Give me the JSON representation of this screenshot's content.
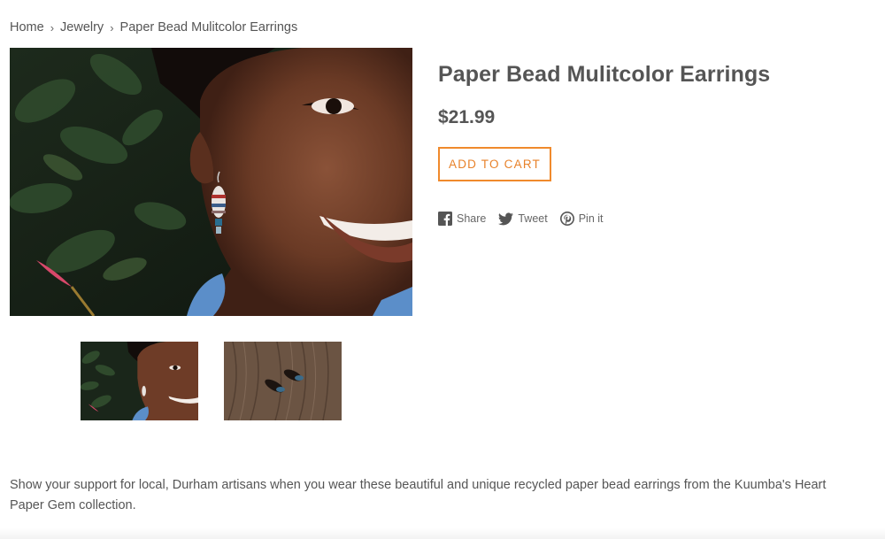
{
  "breadcrumb": {
    "home": "Home",
    "separator": "›",
    "category": "Jewelry",
    "current": "Paper Bead Mulitcolor Earrings"
  },
  "product": {
    "title": "Paper Bead Mulitcolor Earrings",
    "price": "$21.99",
    "add_to_cart_label": "ADD TO CART",
    "description": "Show your support for local, Durham artisans when you wear these beautiful and unique recycled paper bead earrings from the Kuumba's Heart Paper Gem collection."
  },
  "social": {
    "share_label": "Share",
    "tweet_label": "Tweet",
    "pin_label": "Pin it"
  },
  "icons": {
    "share": "facebook-icon",
    "tweet": "twitter-icon",
    "pin": "pinterest-icon"
  },
  "colors": {
    "accent": "#f08a2c",
    "text": "#555555"
  }
}
